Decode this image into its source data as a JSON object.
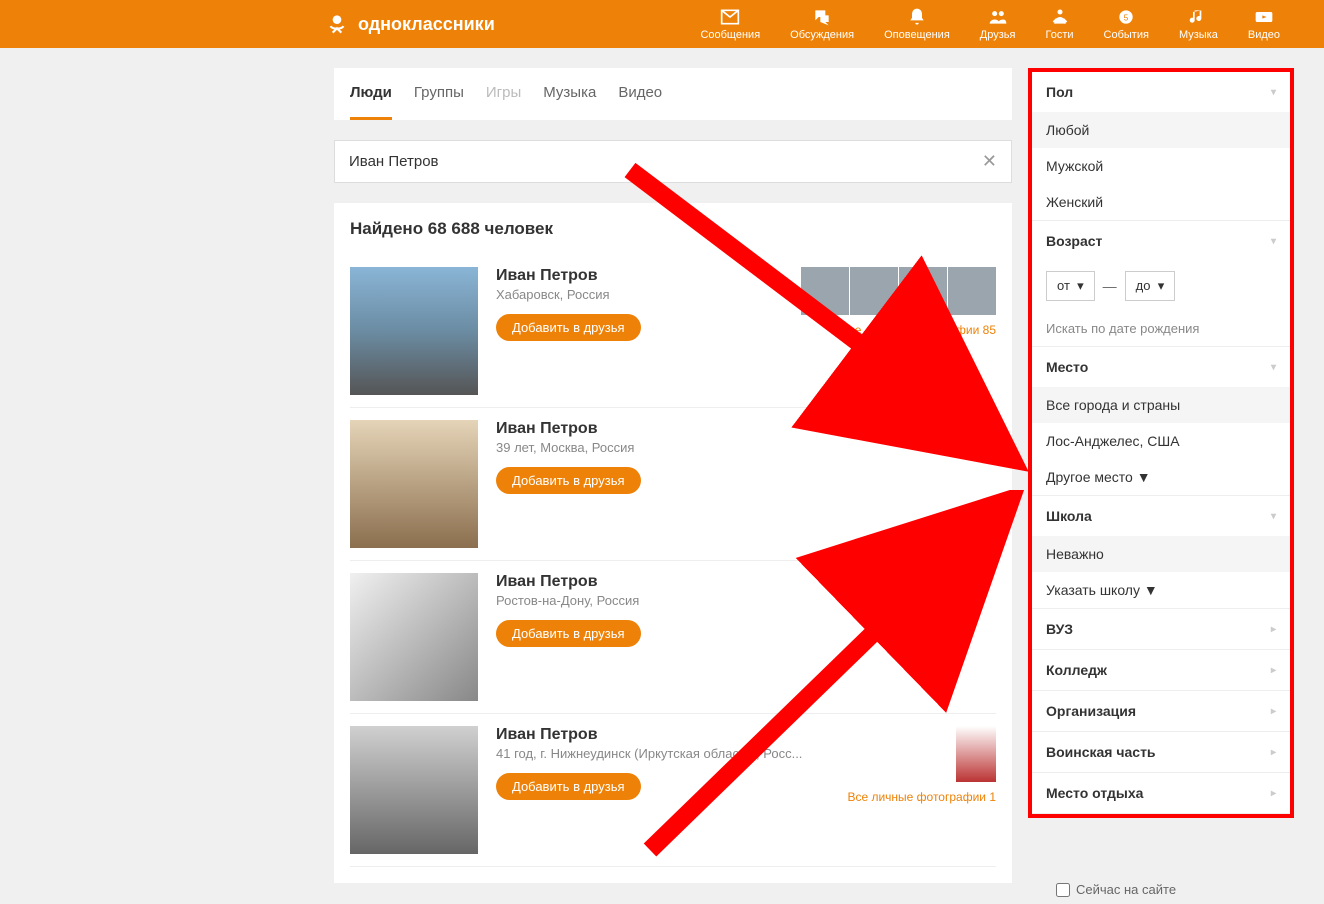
{
  "site": {
    "name": "одноклассники"
  },
  "nav": [
    {
      "label": "Сообщения",
      "icon": "mail"
    },
    {
      "label": "Обсуждения",
      "icon": "chat"
    },
    {
      "label": "Оповещения",
      "icon": "bell"
    },
    {
      "label": "Друзья",
      "icon": "friends"
    },
    {
      "label": "Гости",
      "icon": "guests"
    },
    {
      "label": "События",
      "icon": "events"
    },
    {
      "label": "Музыка",
      "icon": "music"
    },
    {
      "label": "Видео",
      "icon": "video"
    }
  ],
  "tabs": [
    {
      "label": "Люди",
      "active": true
    },
    {
      "label": "Группы",
      "active": false
    },
    {
      "label": "Игры",
      "active": false
    },
    {
      "label": "Музыка",
      "active": false
    },
    {
      "label": "Видео",
      "active": false
    }
  ],
  "search": {
    "value": "Иван Петров"
  },
  "results_header": "Найдено 68 688 человек",
  "results": [
    {
      "name": "Иван Петров",
      "meta": "Хабаровск, Россия",
      "add": "Добавить в друзья",
      "photos_link": "Все личные фотографии 85",
      "has_thumbs": true
    },
    {
      "name": "Иван Петров",
      "meta": "39 лет, Москва, Россия",
      "add": "Добавить в друзья",
      "has_thumbs": false
    },
    {
      "name": "Иван Петров",
      "meta": "Ростов-на-Дону, Россия",
      "add": "Добавить в друзья",
      "has_thumbs": false
    },
    {
      "name": "Иван Петров",
      "meta": "41 год, г. Нижнеудинск (Иркутская область), Росс...",
      "add": "Добавить в друзья",
      "photos_link": "Все личные фотографии 1",
      "has_one_thumb": true
    }
  ],
  "filters": {
    "gender": {
      "title": "Пол",
      "options": [
        "Любой",
        "Мужской",
        "Женский"
      ],
      "selected": 0
    },
    "age": {
      "title": "Возраст",
      "from": "от",
      "to": "до",
      "birth_link": "Искать по дате рождения"
    },
    "place": {
      "title": "Место",
      "options": [
        "Все города и страны",
        "Лос-Анджелес, США",
        "Другое место ▼"
      ],
      "selected": 0
    },
    "school": {
      "title": "Школа",
      "options": [
        "Неважно",
        "Указать школу ▼"
      ],
      "selected": 0
    },
    "collapsed": [
      "ВУЗ",
      "Колледж",
      "Организация",
      "Воинская часть",
      "Место отдыха"
    ]
  },
  "now_online": "Сейчас на сайте"
}
